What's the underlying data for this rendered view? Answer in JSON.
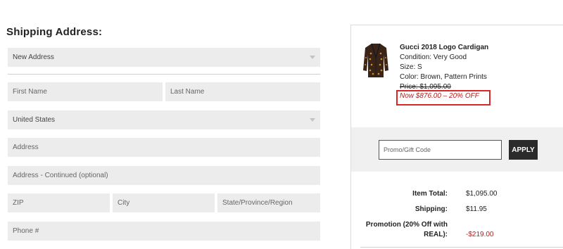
{
  "shipping": {
    "heading": "Shipping Address:",
    "address_select": "New Address",
    "first_name_placeholder": "First Name",
    "last_name_placeholder": "Last Name",
    "country_select": "United States",
    "address_placeholder": "Address",
    "address2_placeholder": "Address - Continued (optional)",
    "zip_placeholder": "ZIP",
    "city_placeholder": "City",
    "state_placeholder": "State/Province/Region",
    "phone_placeholder": "Phone #"
  },
  "product": {
    "name": "Gucci 2018 Logo Cardigan",
    "condition": "Condition: Very Good",
    "size": "Size: S",
    "color": "Color: Brown, Pattern Prints",
    "original_price": "Price: $1,095.00",
    "sale_price": "Now $876.00 – 20% OFF",
    "image_icon": "cardigan-image"
  },
  "promo": {
    "placeholder": "Promo/Gift Code",
    "apply_label": "APPLY"
  },
  "summary": {
    "item_total_label": "Item Total:",
    "item_total_value": "$1,095.00",
    "shipping_label": "Shipping:",
    "shipping_value": "$11.95",
    "promotion_label_1": "Promotion (20% Off with",
    "promotion_label_2": "REAL):",
    "promotion_value": "-$219.00"
  },
  "colors": {
    "field_bg": "#ececec",
    "highlight_border": "#d62828",
    "discount_text": "#b02020",
    "apply_button": "#2b2b2b"
  }
}
